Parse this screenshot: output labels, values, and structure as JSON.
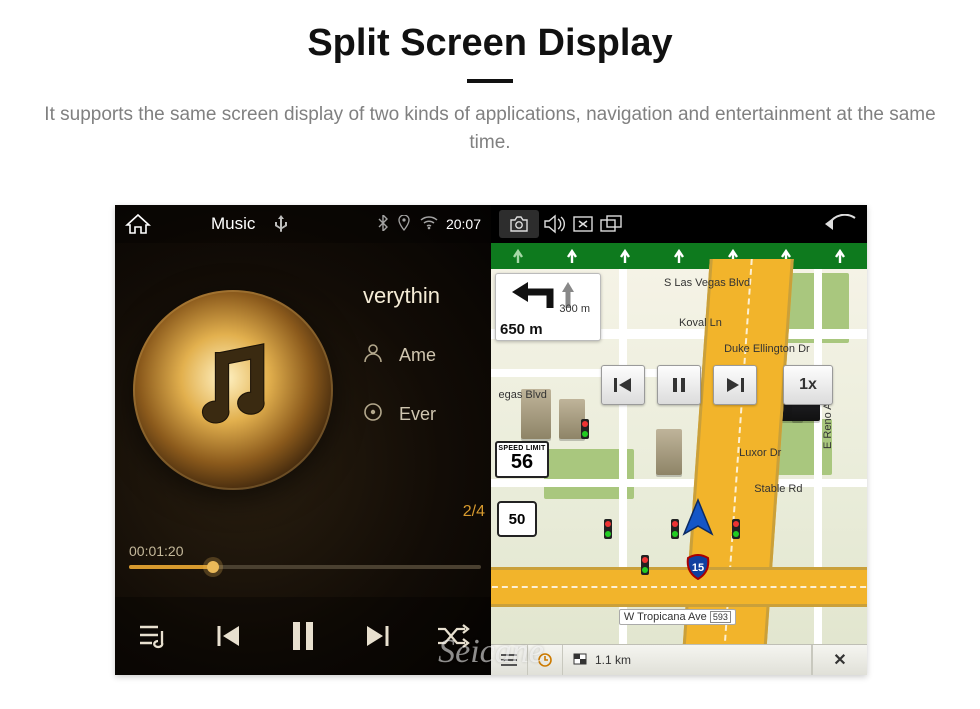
{
  "header": {
    "title": "Split Screen Display",
    "subtitle": "It supports the same screen display of two kinds of applications, navigation and entertainment at the same time."
  },
  "watermark": "Seicane",
  "music": {
    "status": {
      "label": "Music",
      "source": "USB",
      "clock": "20:07"
    },
    "track": {
      "title": "verythin",
      "artist": "Ame",
      "album": "Ever"
    },
    "counter": "2/4",
    "time_played": "00:01:20",
    "controls": {
      "playlist": "Playlist",
      "prev": "Previous",
      "pause": "Pause",
      "next": "Next",
      "shuffle": "Shuffle"
    }
  },
  "nav": {
    "lanes_active": [
      false,
      true,
      true,
      true,
      true,
      true,
      true
    ],
    "turn": {
      "ahead": "300 m",
      "total": "650 m"
    },
    "speed": {
      "label": "SPEED LIMIT",
      "value": "56"
    },
    "route_shield": "50",
    "playback": {
      "prev": "Prev",
      "pause": "Pause",
      "next": "Next",
      "speed": "1x"
    },
    "streets": {
      "s_las_vegas": "S Las Vegas Blvd",
      "koval": "Koval Ln",
      "duke": "Duke Ellington Dr",
      "luxor": "Luxor Dr",
      "stable": "Stable Rd",
      "reno": "E Reno Ave",
      "tropicana": "W Tropicana Ave",
      "trop_exit": "593"
    },
    "interstate": "15",
    "bottom": {
      "eta": "",
      "dist": "1.1 km",
      "close": "✕"
    }
  }
}
